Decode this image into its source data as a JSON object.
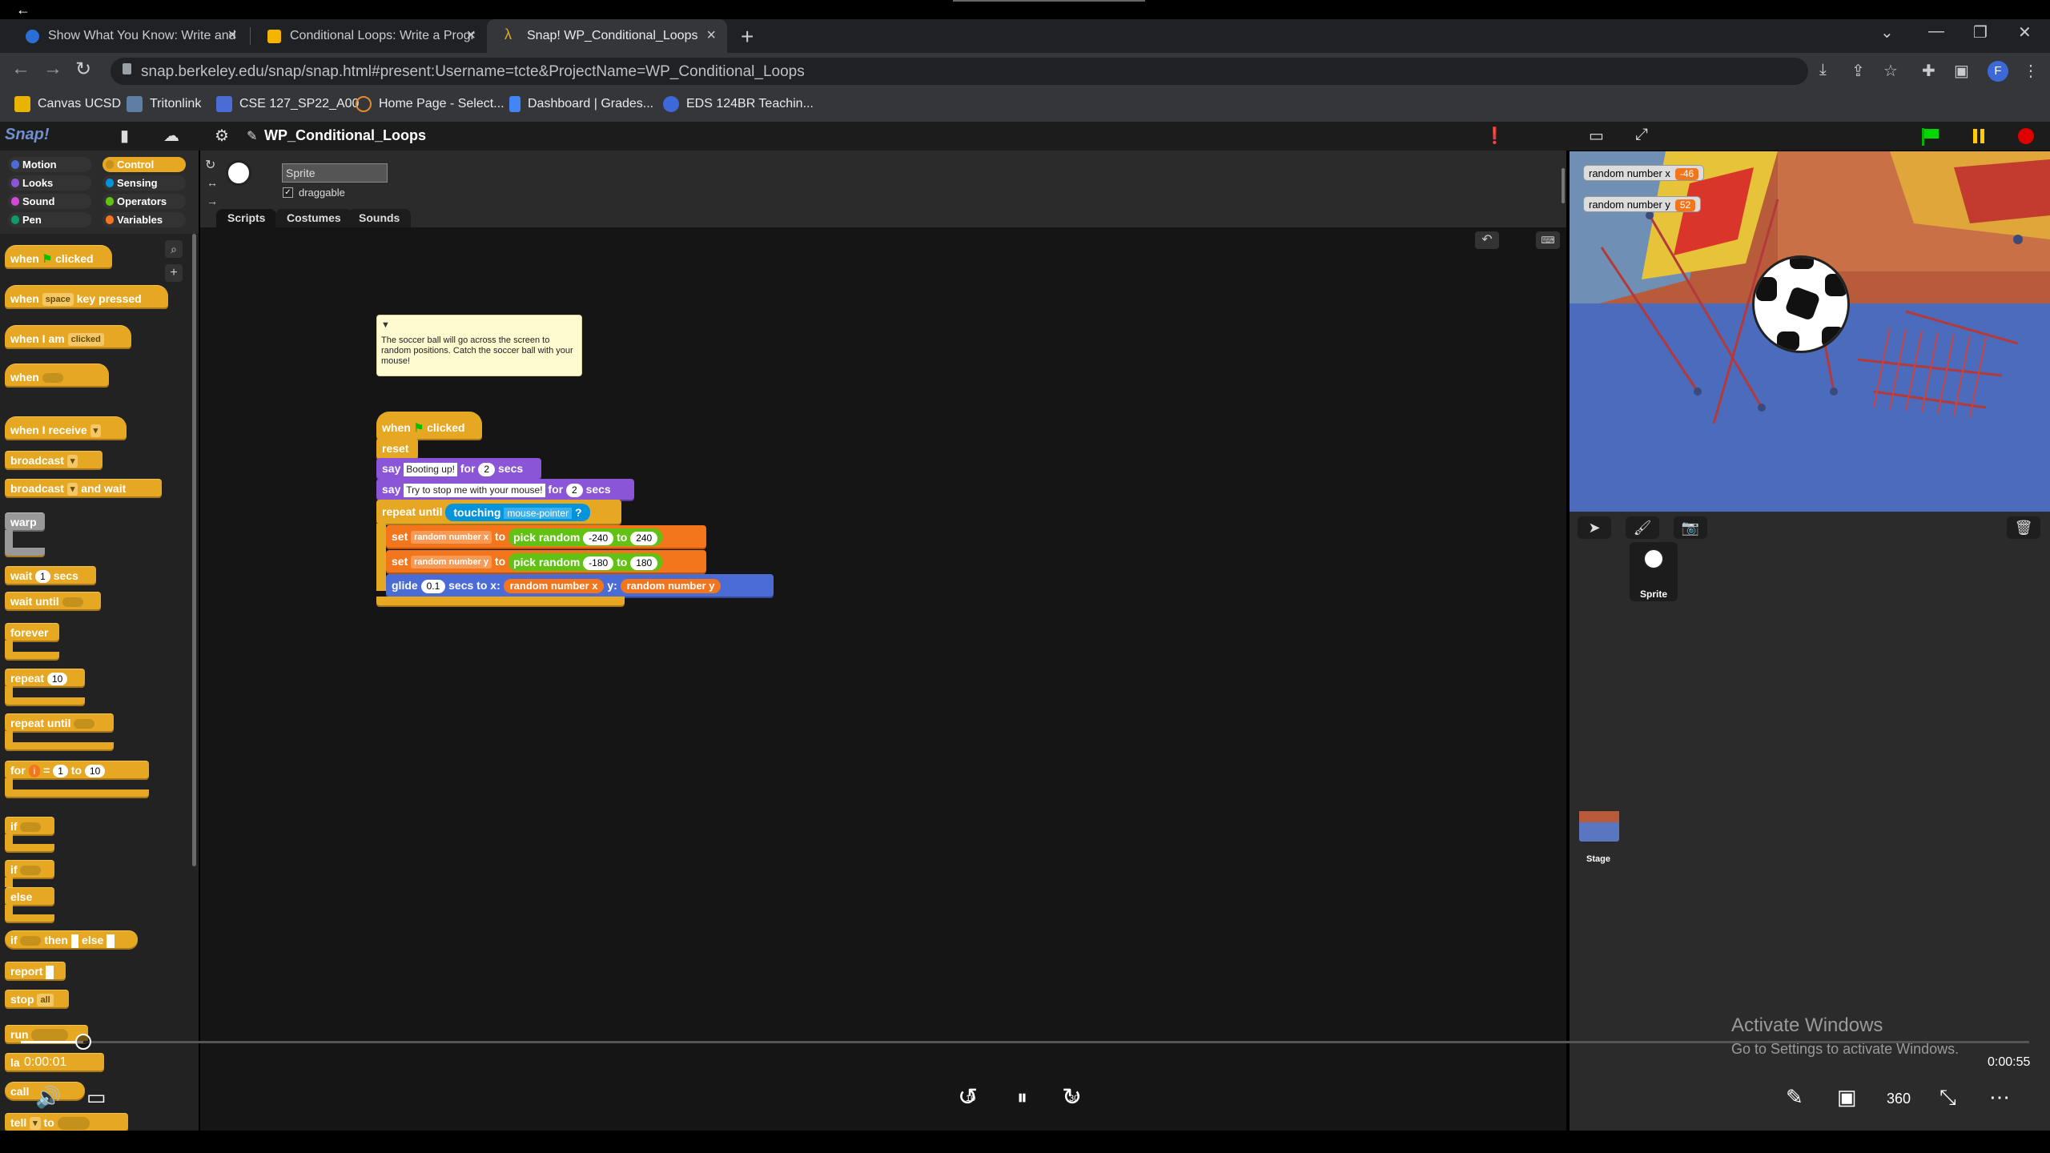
{
  "browser": {
    "tabs": [
      {
        "label": "Show What You Know: Write and",
        "favicon_color": "#2b6fd6"
      },
      {
        "label": "Conditional Loops: Write a Progr",
        "favicon_color": "#f4b400"
      },
      {
        "label": "Snap! WP_Conditional_Loops",
        "favicon_color": "#e6a822"
      }
    ],
    "url": "snap.berkeley.edu/snap/snap.html#present:Username=tcte&ProjectName=WP_Conditional_Loops",
    "profile_initial": "F",
    "bookmarks": [
      {
        "label": "Canvas UCSD",
        "icon_color": "#e8b400"
      },
      {
        "label": "Tritonlink",
        "icon_color": "#5f7ea3"
      },
      {
        "label": "CSE 127_SP22_A00",
        "icon_color": "#4a6cd4"
      },
      {
        "label": "Home Page - Select...",
        "icon_color": "#e58a2b"
      },
      {
        "label": "Dashboard | Grades...",
        "icon_color": "#4285f4"
      },
      {
        "label": "EDS 124BR Teachin...",
        "icon_color": "#3d68d8"
      }
    ]
  },
  "snap": {
    "logo": "Snap!",
    "project_title": "WP_Conditional_Loops",
    "categories": [
      "Motion",
      "Looks",
      "Sound",
      "Pen",
      "Control",
      "Sensing",
      "Operators",
      "Variables"
    ],
    "category_colors": [
      "#4a6cd4",
      "#8a55d7",
      "#cf4ad9",
      "#0e9a6c",
      "#e6a822",
      "#0494dc",
      "#62c213",
      "#f3761d"
    ],
    "sprite_name": "Sprite",
    "draggable_label": "draggable",
    "editor_tabs": [
      "Scripts",
      "Costumes",
      "Sounds"
    ],
    "palette_blocks": {
      "when_flag": "when",
      "clicked": "clicked",
      "when_key": "when",
      "key_slot": "space",
      "key_pressed": "key pressed",
      "when_i_am": "when I am",
      "i_am_slot": "clicked",
      "when_cond": "when",
      "when_receive": "when I receive",
      "broadcast": "broadcast",
      "broadcast_wait": "broadcast",
      "and_wait": "and wait",
      "warp": "warp",
      "wait": "wait",
      "wait_val": "1",
      "secs": "secs",
      "wait_until": "wait until",
      "forever": "forever",
      "repeat": "repeat",
      "repeat_val": "10",
      "repeat_until": "repeat until",
      "for": "for",
      "for_var": "i",
      "for_eq": "=",
      "for_from": "1",
      "for_to": "to",
      "for_end": "10",
      "if": "if",
      "if2": "if",
      "else": "else",
      "if_then_else": "if",
      "then": "then",
      "else2": "else",
      "report": "report",
      "stop": "stop",
      "stop_val": "all",
      "run": "run",
      "launch": "la",
      "call": "call",
      "tell": "tell",
      "tell_to": "to"
    },
    "comment": "The soccer ball will go across the screen to random positions. Catch the soccer ball with your mouse!",
    "script": {
      "when": "when",
      "clicked": "clicked",
      "reset": "reset",
      "say1": "say",
      "say1_text": "Booting up!",
      "for1": "for",
      "say1_secs": "2",
      "secs1": "secs",
      "say2": "say",
      "say2_text": "Try to stop me with your mouse!",
      "for2": "for",
      "say2_secs": "2",
      "secs2": "secs",
      "repeat_until": "repeat until",
      "touching": "touching",
      "touching_target": "mouse-pointer",
      "qmark": "?",
      "set1": "set",
      "set1_var": "random number x",
      "to1": "to",
      "pick1": "pick random",
      "pick1_from": "-240",
      "pick1_to_label": "to",
      "pick1_to": "240",
      "set2": "set",
      "set2_var": "random number y",
      "to2": "to",
      "pick2": "pick random",
      "pick2_from": "-180",
      "pick2_to_label": "to",
      "pick2_to": "180",
      "glide": "glide",
      "glide_secs": "0.1",
      "secs_to_x": "secs to x:",
      "glide_x": "random number x",
      "y": "y:",
      "glide_y": "random number y"
    },
    "watchers": [
      {
        "label": "random number x",
        "value": "-46"
      },
      {
        "label": "random number y",
        "value": "52"
      }
    ],
    "sprite_label": "Sprite",
    "stage_label": "Stage"
  },
  "video": {
    "current_time": "0:00:01",
    "total_time": "0:00:55",
    "progress": 0.031,
    "rewind_label": "10",
    "forward_label": "30"
  },
  "overlay": {
    "activate_title": "Activate Windows",
    "activate_sub": "Go to Settings to activate Windows."
  }
}
